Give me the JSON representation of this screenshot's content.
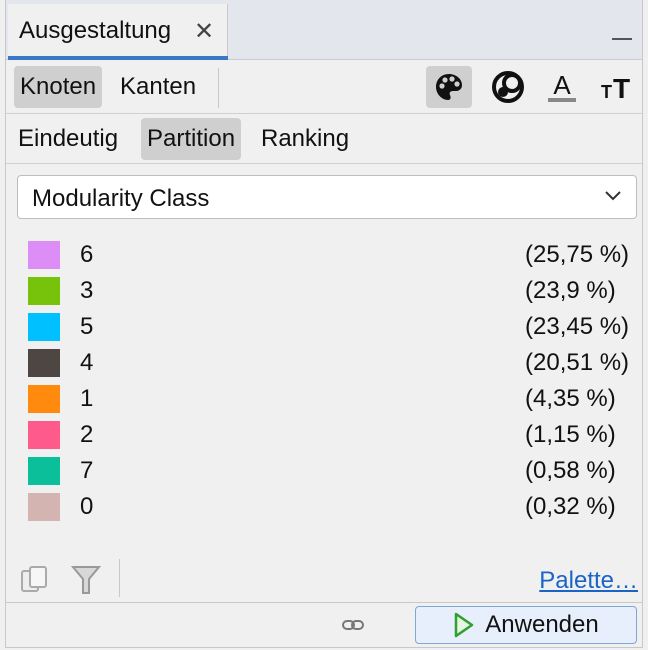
{
  "window": {
    "tab_title": "Ausgestaltung",
    "close_glyph": "✕"
  },
  "target_tabs": [
    "Knoten",
    "Kanten"
  ],
  "target_selected": "Knoten",
  "tools": [
    "palette-icon",
    "size-rings-icon",
    "label-color-icon",
    "label-size-icon"
  ],
  "mode_tabs": [
    "Eindeutig",
    "Partition",
    "Ranking"
  ],
  "mode_selected": "Partition",
  "attribute_dropdown": {
    "value": "Modularity Class"
  },
  "partitions": [
    {
      "label": "6",
      "percent": "(25,75 %)",
      "color": "#dd8ef6"
    },
    {
      "label": "3",
      "percent": "(23,9 %)",
      "color": "#77c30c"
    },
    {
      "label": "5",
      "percent": "(23,45 %)",
      "color": "#00c0ff"
    },
    {
      "label": "4",
      "percent": "(20,51 %)",
      "color": "#4e4643"
    },
    {
      "label": "1",
      "percent": "(4,35 %)",
      "color": "#ff8a0e"
    },
    {
      "label": "2",
      "percent": "(1,15 %)",
      "color": "#ff5a8c"
    },
    {
      "label": "7",
      "percent": "(0,58 %)",
      "color": "#0bbf9a"
    },
    {
      "label": "0",
      "percent": "(0,32 %)",
      "color": "#d4b4b1"
    }
  ],
  "bottom": {
    "palette_link": "Palette…",
    "apply_label": "Anwenden"
  },
  "colors": {
    "accent": "#3c78c8",
    "link": "#1a64c8",
    "apply_icon": "#2ea02e"
  }
}
